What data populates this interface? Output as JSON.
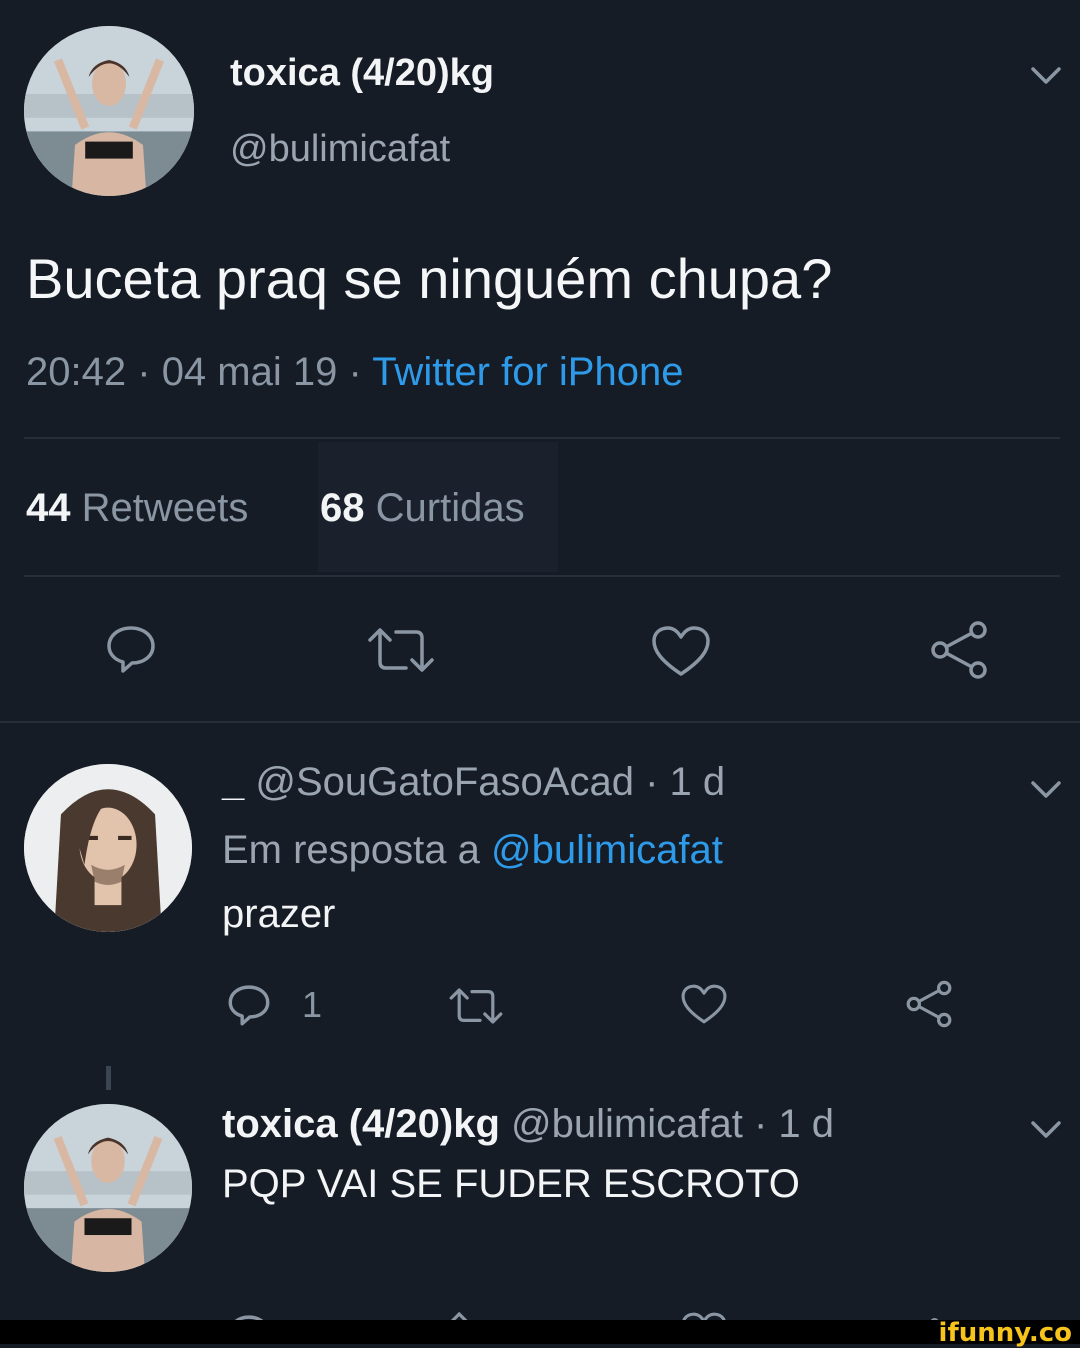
{
  "main_tweet": {
    "display_name": "toxica (4/20)kg",
    "handle": "@bulimicafat",
    "text": "Buceta praq se ninguém chupa?",
    "time": "20:42",
    "date": "04 mai 19",
    "source": "Twitter for iPhone",
    "separator": "·",
    "retweet_count": "44",
    "retweet_label": "Retweets",
    "like_count": "68",
    "like_label": "Curtidas"
  },
  "reply_1": {
    "prefix": "_",
    "handle": "@SouGatoFasoAcad",
    "age": "· 1 d",
    "reply_to_label": "Em resposta a",
    "reply_to_handle": "@bulimicafat",
    "text": "prazer",
    "reply_count": "1"
  },
  "reply_2": {
    "display_name": "toxica (4/20)kg",
    "handle": "@bulimicafat",
    "age": "· 1 d",
    "text": "PQP VAI SE FUDER ESCROTO"
  },
  "watermark": "ifunny.co",
  "icons": [
    "reply-icon",
    "retweet-icon",
    "heart-icon",
    "share-icon",
    "chevron-down-icon"
  ],
  "colors": {
    "background": "#161c26",
    "link": "#2e9bea",
    "muted": "#8a96a3",
    "watermark": "#f7c41d"
  }
}
